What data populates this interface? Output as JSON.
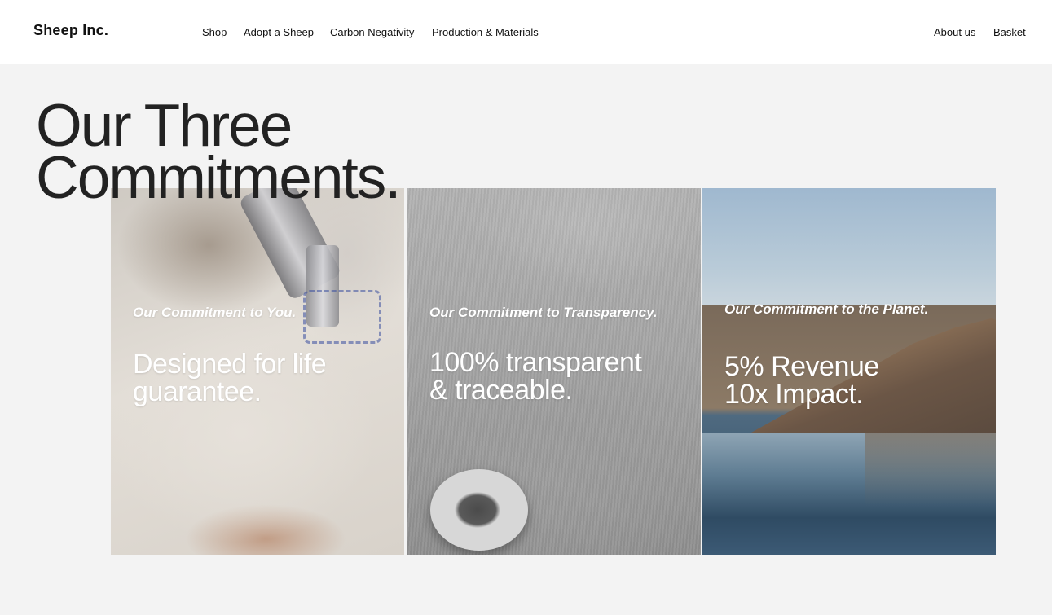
{
  "header": {
    "brand": "Sheep Inc.",
    "nav_left": [
      "Shop",
      "Adopt a Sheep",
      "Carbon Negativity",
      "Production & Materials"
    ],
    "nav_right": [
      "About us",
      "Basket"
    ]
  },
  "hero": {
    "title_line1": "Our Three",
    "title_line2": "Commitments."
  },
  "cards": [
    {
      "kicker": "Our Commitment to You.",
      "headline_line1": "Designed for life",
      "headline_line2": "guarantee."
    },
    {
      "kicker": "Our Commitment to Transparency.",
      "headline_line1": "100% transparent",
      "headline_line2": "& traceable."
    },
    {
      "kicker": "Our Commitment to the Planet.",
      "headline_line1": "5% Revenue",
      "headline_line2": "10x Impact."
    }
  ],
  "colors": {
    "page_background": "#f3f3f3",
    "header_background": "#ffffff",
    "text": "#111111",
    "overlay_text": "#ffffff"
  }
}
